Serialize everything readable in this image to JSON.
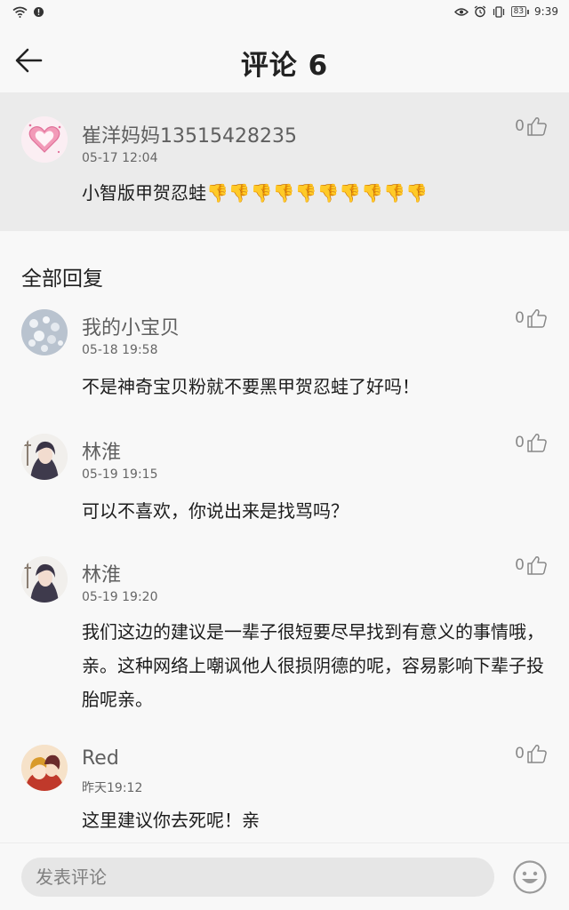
{
  "status_bar": {
    "time": "9:39",
    "battery": "83"
  },
  "header": {
    "title": "评论 6"
  },
  "main_comment": {
    "user": "崔洋妈妈13515428235",
    "time": "05-17 12:04",
    "text": "小智版甲贺忍蛙",
    "thumbs": "👎👎👎👎👎👎👎👎👎👎",
    "likes": "0"
  },
  "section_title": "全部回复",
  "replies": [
    {
      "user": "我的小宝贝",
      "time": "05-18 19:58",
      "text": "不是神奇宝贝粉就不要黑甲贺忍蛙了好吗！",
      "likes": "0"
    },
    {
      "user": "林淮",
      "time": "05-19 19:15",
      "text": "可以不喜欢，你说出来是找骂吗？",
      "likes": "0"
    },
    {
      "user": "林淮",
      "time": "05-19 19:20",
      "text": "我们这边的建议是一辈子很短要尽早找到有意义的事情哦，亲。这种网络上嘲讽他人很损阴德的呢，容易影响下辈子投胎呢亲。",
      "likes": "0"
    },
    {
      "user": "Red",
      "time": "昨天19:12",
      "text": "这里建议你去死呢！亲",
      "likes": "0"
    }
  ],
  "footer": {
    "placeholder": "发表评论"
  },
  "colors": {
    "header_bg": "#f8f8f8",
    "highlight_bg": "#ebebeb",
    "input_bg": "#e6e6e6"
  }
}
